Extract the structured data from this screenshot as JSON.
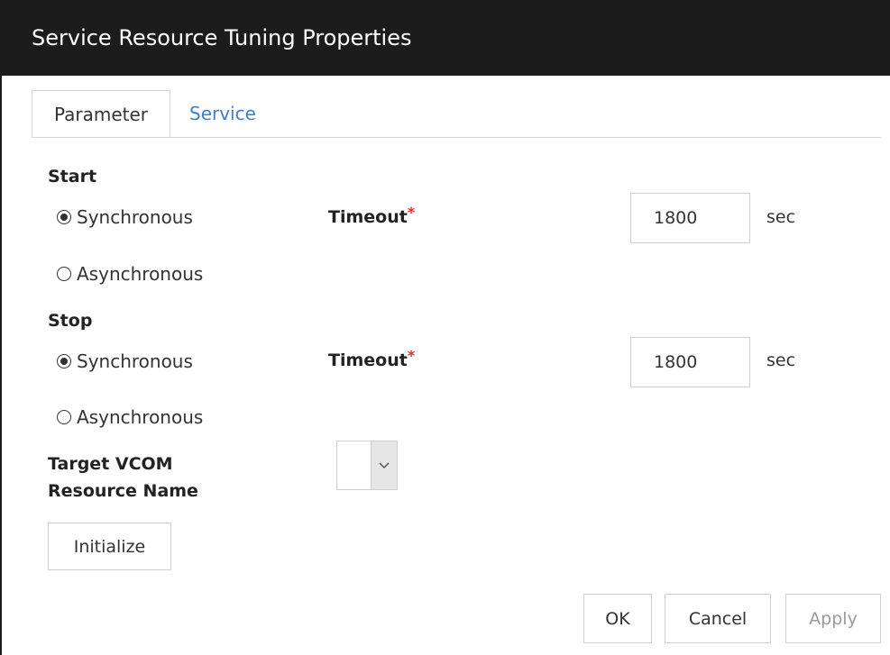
{
  "dialog": {
    "title": "Service Resource Tuning Properties"
  },
  "tabs": [
    {
      "label": "Parameter",
      "active": true
    },
    {
      "label": "Service",
      "active": false
    }
  ],
  "start": {
    "label": "Start",
    "sync_label": "Synchronous",
    "async_label": "Asynchronous",
    "selected": "Synchronous",
    "timeout_label": "Timeout",
    "required_mark": "*",
    "timeout_value": "1800",
    "unit": "sec"
  },
  "stop": {
    "label": "Stop",
    "sync_label": "Synchronous",
    "async_label": "Asynchronous",
    "selected": "Synchronous",
    "timeout_label": "Timeout",
    "required_mark": "*",
    "timeout_value": "1800",
    "unit": "sec"
  },
  "target_vcom": {
    "label_line1": "Target VCOM",
    "label_line2": "Resource Name",
    "value": ""
  },
  "buttons": {
    "initialize": "Initialize",
    "ok": "OK",
    "cancel": "Cancel",
    "apply": "Apply"
  },
  "colors": {
    "titlebar": "#1c1c1c",
    "tab_link": "#3c7fc4",
    "required": "#d9302c"
  }
}
